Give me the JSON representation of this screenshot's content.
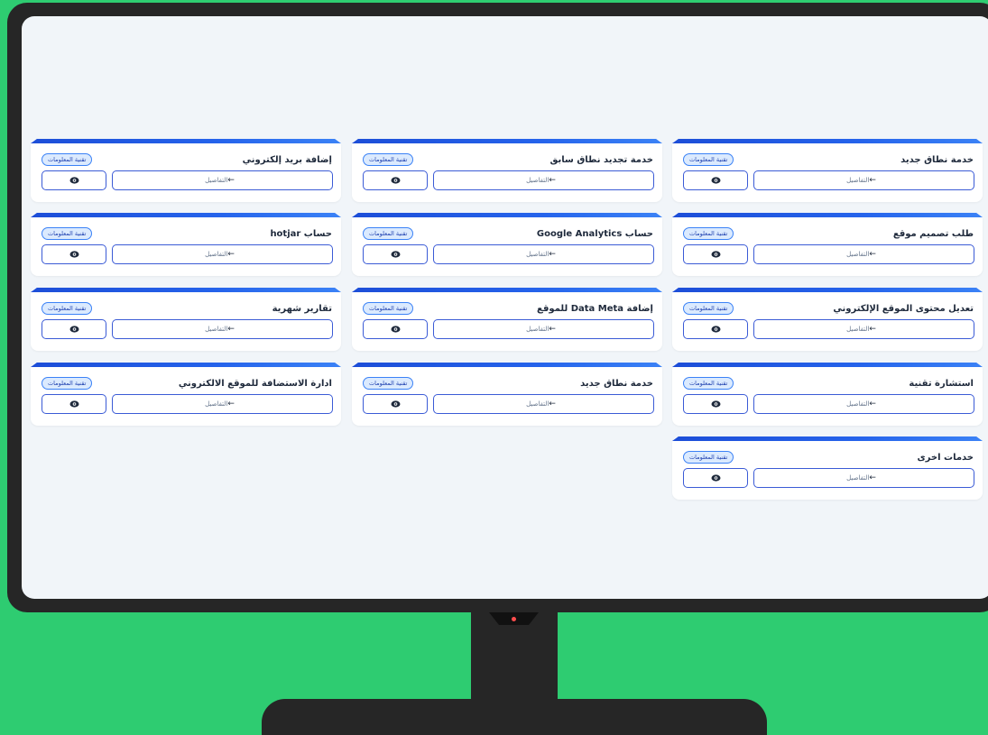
{
  "badge_label": "تقنية المعلومات",
  "details_label": "التفاصيل",
  "details_arrow": "←",
  "colors": {
    "accent": "#2563eb",
    "background": "#2ecc71",
    "monitor": "#262626"
  },
  "services": [
    {
      "title": "خدمة نطاق جديد"
    },
    {
      "title": "خدمة تجديد نطاق سابق"
    },
    {
      "title": "إضافة بريد إلكتروني"
    },
    {
      "title": "طلب تصميم موقع"
    },
    {
      "title": "حساب Google Analytics"
    },
    {
      "title": "حساب hotjar"
    },
    {
      "title": "تعديل محتوى الموقع الإلكتروني"
    },
    {
      "title": "إضافة Data Meta للموقع"
    },
    {
      "title": "تقارير شهرية"
    },
    {
      "title": "استشارة تقنية"
    },
    {
      "title": "خدمة نطاق جديد"
    },
    {
      "title": "ادارة الاستضافة للموقع الالكتروني"
    },
    {
      "title": "خدمات اخرى"
    }
  ]
}
